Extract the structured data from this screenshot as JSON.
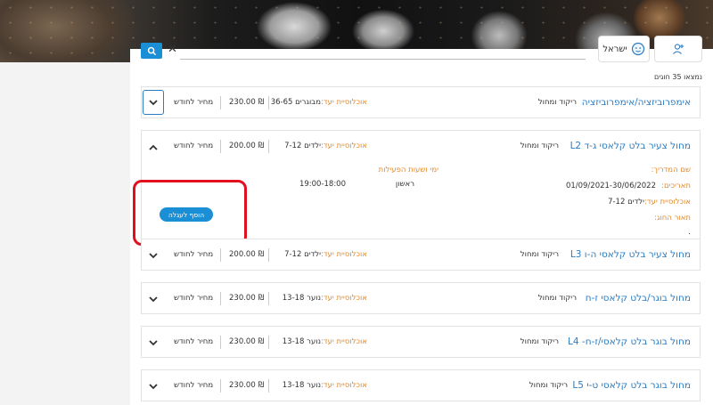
{
  "header": {
    "language_label": "ישראל",
    "results_count": "נמצאו 35 חוגים"
  },
  "labels": {
    "age_label": "אוכלוסיית יעד:",
    "monthly_price": "מחיר לחודש",
    "currency": "₪"
  },
  "courses": [
    {
      "title": "אימפרוביזציה/אימפרוביזציה",
      "genre": "ריקוד ומחול",
      "age": "מבוגרים 36-65",
      "price": "230.00",
      "expanded": false
    },
    {
      "title": "מחול צעיר בלט קלאסי ג-ד L2",
      "genre": "ריקוד ומחול",
      "age": "ילדים 7-12",
      "price": "200.00",
      "expanded": true
    },
    {
      "title": "מחול צעיר בלט קלאסי ה-ו L3",
      "genre": "ריקוד ומחול",
      "age": "ילדים 7-12",
      "price": "200.00",
      "expanded": false
    },
    {
      "title": "מחול בוגר/בלט קלאסי ז-ח",
      "genre": "ריקוד ומחול",
      "age": "נוער 13-18",
      "price": "230.00",
      "expanded": false
    },
    {
      "title": "מחול בוגר בלט קלאסי/ז-ח- L4",
      "genre": "ריקוד ומחול",
      "age": "נוער 13-18",
      "price": "230.00",
      "expanded": false
    },
    {
      "title": "מחול בוגר בלט קלאסי ט-י L5",
      "genre": "ריקוד ומחול",
      "age": "נוער 13-18",
      "price": "230.00",
      "expanded": false
    }
  ],
  "details": {
    "instructor_label": "שם המדריך:",
    "dates_label": "תאריכים:",
    "dates_value": "01/09/2021-30/06/2022",
    "age_label": "אוכלוסיית יעד:",
    "age_value": "ילדים 7-12",
    "description_label": "תאור החוג:",
    "description_value": ".",
    "schedule_heading": "ימי ושעות הפעילות",
    "day": "ראשון",
    "hours": "19:00-18:00",
    "add_to_cart": "הוסף לעגלה"
  },
  "colors": {
    "accent_blue": "#1a8fd6",
    "link_blue": "#2b7cc1",
    "orange": "#e08a2c",
    "highlight_red": "#e0101e"
  }
}
